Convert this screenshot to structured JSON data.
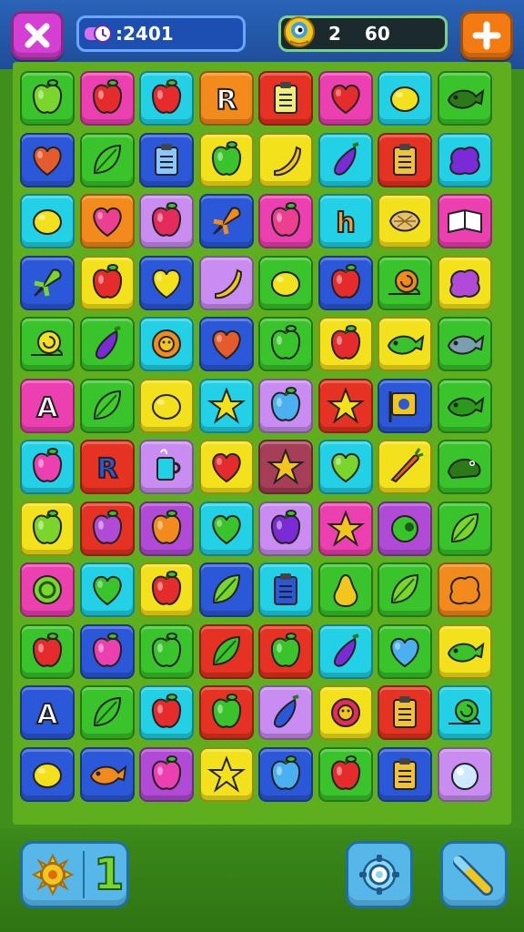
{
  "hud": {
    "score_text": ":2401",
    "moves_level": "2",
    "moves_count": "60"
  },
  "colors": {
    "yellow": "#f3e21b",
    "magenta": "#ec3fb0",
    "cyan": "#22d1e6",
    "orange": "#f28a1c",
    "red": "#e53222",
    "green": "#39c42b",
    "blue": "#2b58d9",
    "purple": "#b14ad6",
    "lilac": "#c98cf0",
    "lime": "#7ad62a",
    "maroon": "#a63e58",
    "teal": "#28c7b7"
  },
  "board": {
    "rows": [
      [
        [
          "green",
          "apple",
          "#7ad62a"
        ],
        [
          "magenta",
          "apple",
          "#e52b2b"
        ],
        [
          "cyan",
          "apple",
          "#e52b2b"
        ],
        [
          "orange",
          "letter-r",
          "#ffffff"
        ],
        [
          "red",
          "clipboard",
          "#f0f070"
        ],
        [
          "magenta",
          "heart",
          "#e52b2b"
        ],
        [
          "cyan",
          "lemon",
          "#f3e21b"
        ],
        [
          "green",
          "fish",
          "#2b7a1a"
        ]
      ],
      [
        [
          "blue",
          "heart",
          "#e55b2b"
        ],
        [
          "green",
          "leaf",
          "#3fcc2b"
        ],
        [
          "blue",
          "clipboard",
          "#8ac7ff"
        ],
        [
          "yellow",
          "apple",
          "#39c42b"
        ],
        [
          "yellow",
          "banana",
          "#f3c61b"
        ],
        [
          "cyan",
          "eggplant",
          "#7a2bd6"
        ],
        [
          "red",
          "clipboard",
          "#f0c23a"
        ],
        [
          "cyan",
          "blob",
          "#7a2bd6"
        ]
      ],
      [
        [
          "cyan",
          "lemon",
          "#f3e21b"
        ],
        [
          "orange",
          "heart",
          "#ec3f8f"
        ],
        [
          "lilac",
          "apple",
          "#e52b5b"
        ],
        [
          "blue",
          "rocket",
          "#f28a1c"
        ],
        [
          "magenta",
          "apple",
          "#ec3f8f"
        ],
        [
          "cyan",
          "letter-h",
          "#f0a040"
        ],
        [
          "yellow",
          "shell",
          "#e6c070"
        ],
        [
          "magenta",
          "book",
          "#ffffff"
        ]
      ],
      [
        [
          "blue",
          "rocket",
          "#7ad62a"
        ],
        [
          "yellow",
          "apple",
          "#e52b2b"
        ],
        [
          "blue",
          "heart",
          "#f3e21b"
        ],
        [
          "lilac",
          "banana",
          "#f3c61b"
        ],
        [
          "green",
          "lemon",
          "#f3e21b"
        ],
        [
          "blue",
          "apple",
          "#e52b2b"
        ],
        [
          "green",
          "snail",
          "#f28a1c"
        ],
        [
          "yellow",
          "blob",
          "#b14ad6"
        ]
      ],
      [
        [
          "green",
          "snail",
          "#f3e21b"
        ],
        [
          "green",
          "eggplant",
          "#7a2bd6"
        ],
        [
          "cyan",
          "flower",
          "#f28a1c"
        ],
        [
          "blue",
          "heart",
          "#e55b2b"
        ],
        [
          "green",
          "apple",
          "#39c42b"
        ],
        [
          "yellow",
          "apple",
          "#e52b2b"
        ],
        [
          "yellow",
          "fish",
          "#39c42b"
        ],
        [
          "green",
          "fish",
          "#7aa0b0"
        ]
      ],
      [
        [
          "magenta",
          "letter-a",
          "#ffffff"
        ],
        [
          "green",
          "leaf",
          "#3fcc2b"
        ],
        [
          "yellow",
          "lemon",
          "#f3e21b"
        ],
        [
          "cyan",
          "star",
          "#f3e21b"
        ],
        [
          "lilac",
          "apple",
          "#4ab0f0"
        ],
        [
          "red",
          "star",
          "#f3e21b"
        ],
        [
          "blue",
          "sign",
          "#f3c61b"
        ],
        [
          "green",
          "fish",
          "#2b9a1a"
        ]
      ],
      [
        [
          "cyan",
          "apple",
          "#ec3fb0"
        ],
        [
          "red",
          "letter-r",
          "#2b58d9"
        ],
        [
          "lilac",
          "mug",
          "#22d1e6"
        ],
        [
          "yellow",
          "heart",
          "#e52b2b"
        ],
        [
          "maroon",
          "star",
          "#f3c61b"
        ],
        [
          "cyan",
          "heart",
          "#7ad62a"
        ],
        [
          "yellow",
          "carrot",
          "#f25a1c"
        ],
        [
          "green",
          "frog",
          "#2b7a1a"
        ]
      ],
      [
        [
          "yellow",
          "apple",
          "#7ad62a"
        ],
        [
          "red",
          "apple",
          "#b14ad6"
        ],
        [
          "purple",
          "apple",
          "#f28a1c"
        ],
        [
          "cyan",
          "heart",
          "#39c42b"
        ],
        [
          "lilac",
          "apple",
          "#7a2bd6"
        ],
        [
          "magenta",
          "star",
          "#f3c61b"
        ],
        [
          "purple",
          "pea",
          "#39c42b"
        ],
        [
          "green",
          "leaf",
          "#7ad62a"
        ]
      ],
      [
        [
          "magenta",
          "ring",
          "#7ad62a"
        ],
        [
          "cyan",
          "heart",
          "#39c42b"
        ],
        [
          "yellow",
          "apple",
          "#e52b2b"
        ],
        [
          "blue",
          "leaf",
          "#7ad62a"
        ],
        [
          "cyan",
          "clipboard",
          "#2b58d9"
        ],
        [
          "green",
          "pear",
          "#f3c61b"
        ],
        [
          "green",
          "leaf",
          "#7ad62a"
        ],
        [
          "orange",
          "blob",
          "#f28a1c"
        ]
      ],
      [
        [
          "green",
          "apple",
          "#e52b2b"
        ],
        [
          "blue",
          "apple",
          "#ec3fb0"
        ],
        [
          "green",
          "apple",
          "#39c42b"
        ],
        [
          "red",
          "leaf",
          "#39c42b"
        ],
        [
          "red",
          "apple",
          "#39c42b"
        ],
        [
          "cyan",
          "eggplant",
          "#7a2bd6"
        ],
        [
          "green",
          "heart",
          "#4ab0f0"
        ],
        [
          "yellow",
          "fish",
          "#39c42b"
        ]
      ],
      [
        [
          "blue",
          "letter-a",
          "#ffffff"
        ],
        [
          "green",
          "leaf",
          "#39c42b"
        ],
        [
          "cyan",
          "apple",
          "#e52b2b"
        ],
        [
          "red",
          "apple",
          "#39c42b"
        ],
        [
          "lilac",
          "eggplant",
          "#2b58d9"
        ],
        [
          "yellow",
          "flower",
          "#e52b5b"
        ],
        [
          "red",
          "clipboard",
          "#f0c23a"
        ],
        [
          "cyan",
          "snail",
          "#39c42b"
        ]
      ],
      [
        [
          "blue",
          "lemon",
          "#f3e21b"
        ],
        [
          "blue",
          "fish",
          "#f28a1c"
        ],
        [
          "purple",
          "apple",
          "#ec3fb0"
        ],
        [
          "yellow",
          "star",
          "#f3e21b"
        ],
        [
          "blue",
          "apple",
          "#4ab0f0"
        ],
        [
          "green",
          "apple",
          "#e52b2b"
        ],
        [
          "blue",
          "clipboard",
          "#f0c23a"
        ],
        [
          "lilac",
          "bubble",
          "#cfeaff"
        ]
      ]
    ]
  },
  "boosters": {
    "count": "1"
  }
}
